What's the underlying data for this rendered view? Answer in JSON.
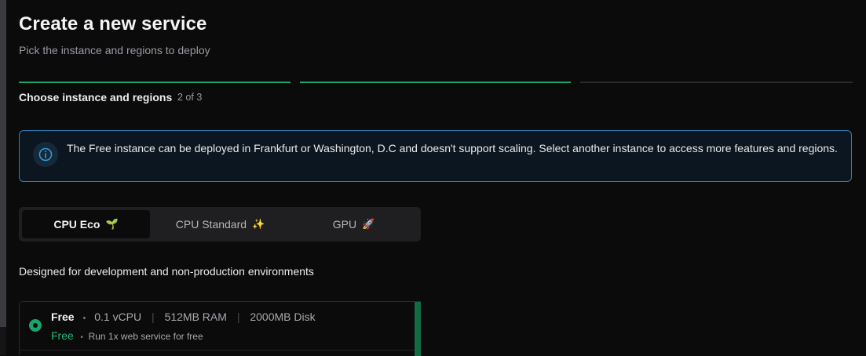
{
  "header": {
    "title": "Create a new service",
    "subtitle": "Pick the instance and regions to deploy"
  },
  "progress": {
    "total_steps": 3,
    "completed_steps": 2,
    "step_heading": "Choose instance and regions",
    "step_count": "2 of 3",
    "active_color": "#1fa56a",
    "inactive_color": "#2a2a2e"
  },
  "info_banner": {
    "icon": "info-icon",
    "text": "The Free instance can be deployed in Frankfurt or Washington, D.C and doesn't support scaling. Select another instance to access more features and regions.",
    "border_color": "#2c7fb8"
  },
  "instance_tabs": [
    {
      "label": "CPU Eco",
      "emoji": "🌱",
      "selected": true
    },
    {
      "label": "CPU Standard",
      "emoji": "✨",
      "selected": false
    },
    {
      "label": "GPU",
      "emoji": "🚀",
      "selected": false
    }
  ],
  "category_description": "Designed for development and non-production environments",
  "plans": [
    {
      "name": "Free",
      "bullet": "•",
      "cpu": "0.1 vCPU",
      "ram": "512MB RAM",
      "disk": "2000MB Disk",
      "separator": "|",
      "price": "Free",
      "note": "Run 1x web service for free",
      "selected": true,
      "accent_color": "#1aa36a"
    }
  ]
}
